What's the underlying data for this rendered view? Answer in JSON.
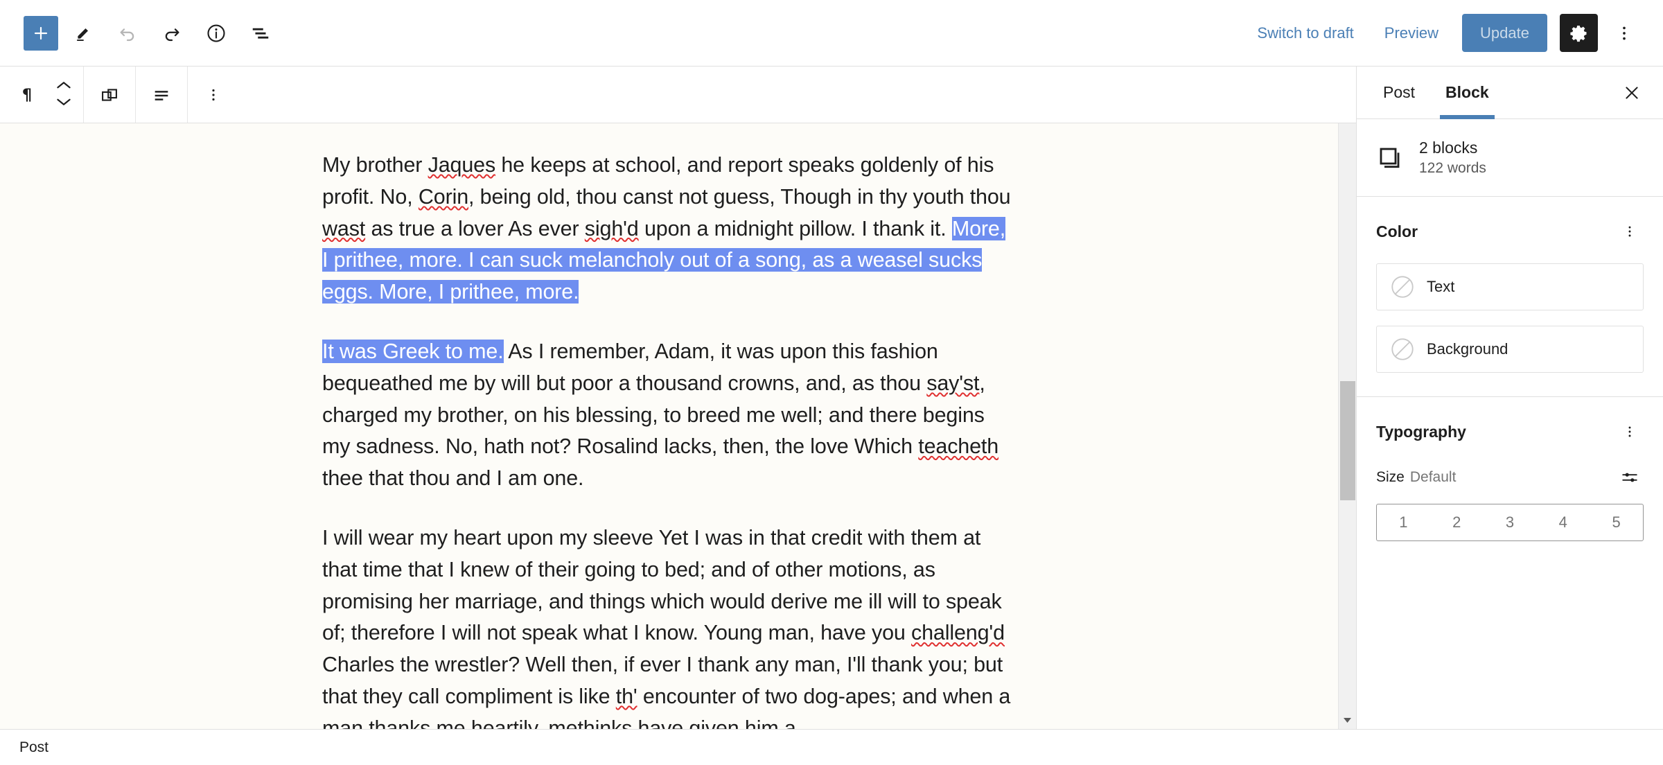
{
  "header": {
    "add_block_label": "+",
    "tools": [
      "edit-pencil",
      "undo",
      "redo",
      "info",
      "list-view"
    ],
    "switch_to_draft": "Switch to draft",
    "preview": "Preview",
    "update": "Update",
    "settings_icon": "gear-icon",
    "more_icon": "ellipsis-vertical-icon",
    "accent_color": "#4a7fb5",
    "settings_bg": "#1e1e1e"
  },
  "block_toolbar": {
    "block_type": "paragraph-pilcrow",
    "move_up": "chevron-up",
    "move_down": "chevron-down",
    "copy": "copy-blocks-icon",
    "align": "align-left-icon",
    "more": "ellipsis-vertical-icon"
  },
  "editor": {
    "background_color": "#fdfcf8",
    "selection_color": "#6e8ef0",
    "paragraphs": [
      {
        "id": "p1",
        "runs": [
          {
            "text": "My brother ",
            "style": "normal"
          },
          {
            "text": "Jaques",
            "style": "misspelled"
          },
          {
            "text": " he keeps at school, and report speaks goldenly of his profit. No, ",
            "style": "normal"
          },
          {
            "text": "Corin",
            "style": "misspelled"
          },
          {
            "text": ", being old, thou canst not guess, Though in thy youth thou ",
            "style": "normal"
          },
          {
            "text": "wast",
            "style": "misspelled"
          },
          {
            "text": " as true a lover As ever ",
            "style": "normal"
          },
          {
            "text": "sigh'd",
            "style": "misspelled"
          },
          {
            "text": " upon a midnight pillow. I thank it. ",
            "style": "normal"
          },
          {
            "text": "More, I prithee, more. I can suck melancholy out of a song, as a weasel sucks eggs. More, I prithee, more.",
            "style": "selected"
          }
        ]
      },
      {
        "id": "p2",
        "runs": [
          {
            "text": "It was Greek to me.",
            "style": "selected"
          },
          {
            "text": " As I remember, Adam, it was upon this fashion bequeathed me by will but poor a thousand crowns, and, as thou ",
            "style": "normal"
          },
          {
            "text": "say'st",
            "style": "misspelled"
          },
          {
            "text": ", charged my brother, on his blessing, to breed me well; and there begins my sadness. No, hath not? Rosalind lacks, then, the love Which ",
            "style": "normal"
          },
          {
            "text": "teacheth",
            "style": "misspelled"
          },
          {
            "text": " thee that thou and I am one.",
            "style": "normal"
          }
        ]
      },
      {
        "id": "p3",
        "runs": [
          {
            "text": "I will wear my heart upon my sleeve Yet I was in that credit with them at that time that I knew of their going to bed; and of other motions, as promising her marriage, and things which would derive me ill will to speak of; therefore I will not speak what I know. Young man, have you ",
            "style": "normal"
          },
          {
            "text": "challeng'd",
            "style": "misspelled"
          },
          {
            "text": " Charles the wrestler? Well then, if ever I thank any man, I'll thank you; but that they call compliment is like ",
            "style": "normal"
          },
          {
            "text": "th'",
            "style": "misspelled"
          },
          {
            "text": " encounter of two dog-apes; and when a man thanks me heartily, methinks have given him a",
            "style": "normal"
          }
        ]
      }
    ]
  },
  "sidebar": {
    "tabs": [
      {
        "label": "Post",
        "active": false
      },
      {
        "label": "Block",
        "active": true
      }
    ],
    "close_icon": "close-icon",
    "block_card": {
      "icon": "multiple-blocks-icon",
      "title": "2 blocks",
      "subtitle": "122 words"
    },
    "color_section": {
      "title": "Color",
      "more_icon": "ellipsis-vertical-icon",
      "options": [
        {
          "label": "Text",
          "swatch": "none"
        },
        {
          "label": "Background",
          "swatch": "none"
        }
      ]
    },
    "typography_section": {
      "title": "Typography",
      "more_icon": "ellipsis-vertical-icon",
      "size_label": "Size",
      "size_value": "Default",
      "settings_icon": "sliders-icon",
      "size_steps": [
        "1",
        "2",
        "3",
        "4",
        "5"
      ]
    }
  },
  "footer": {
    "label": "Post"
  }
}
